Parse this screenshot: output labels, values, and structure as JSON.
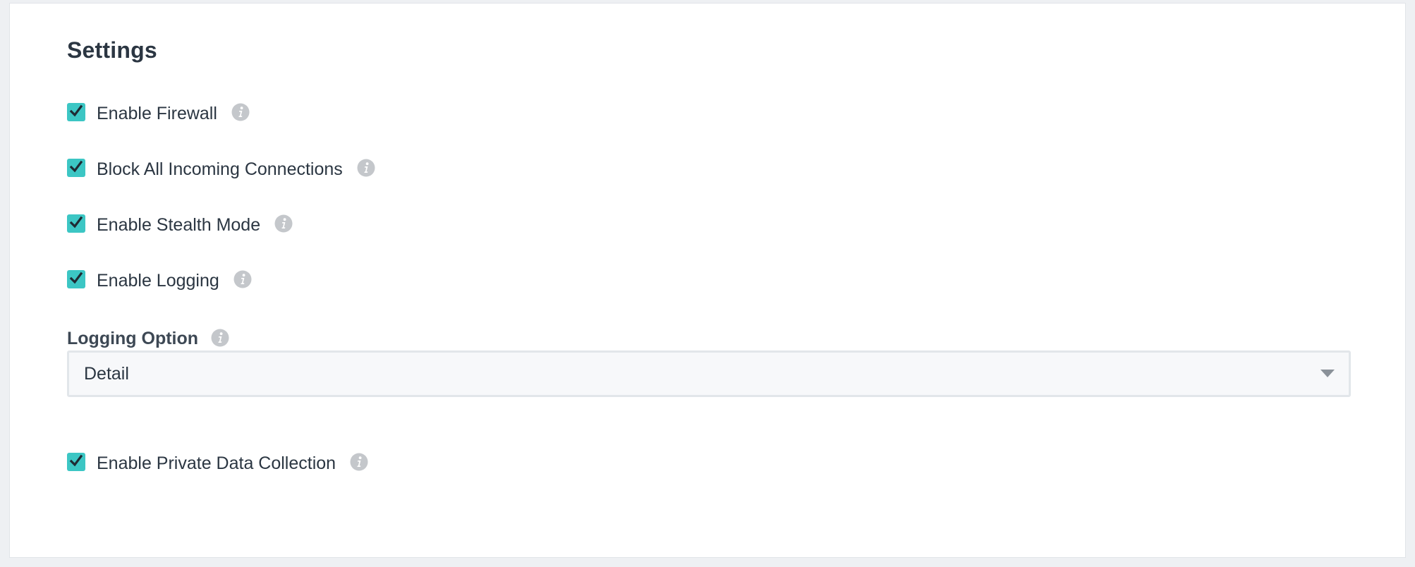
{
  "settings": {
    "title": "Settings",
    "toggles": [
      {
        "label": "Enable Firewall",
        "checked": true
      },
      {
        "label": "Block All Incoming Connections",
        "checked": true
      },
      {
        "label": "Enable Stealth Mode",
        "checked": true
      },
      {
        "label": "Enable Logging",
        "checked": true
      },
      {
        "label": "Enable Private Data Collection",
        "checked": true
      }
    ],
    "logging_option": {
      "label": "Logging Option",
      "selected": "Detail"
    }
  },
  "colors": {
    "checkbox": "#3cc6c4",
    "info_icon": "#c4c7cb",
    "text": "#2b3642"
  },
  "icons": {
    "check": "checkmark-icon",
    "info": "info-icon",
    "dropdown": "caret-down-icon"
  }
}
